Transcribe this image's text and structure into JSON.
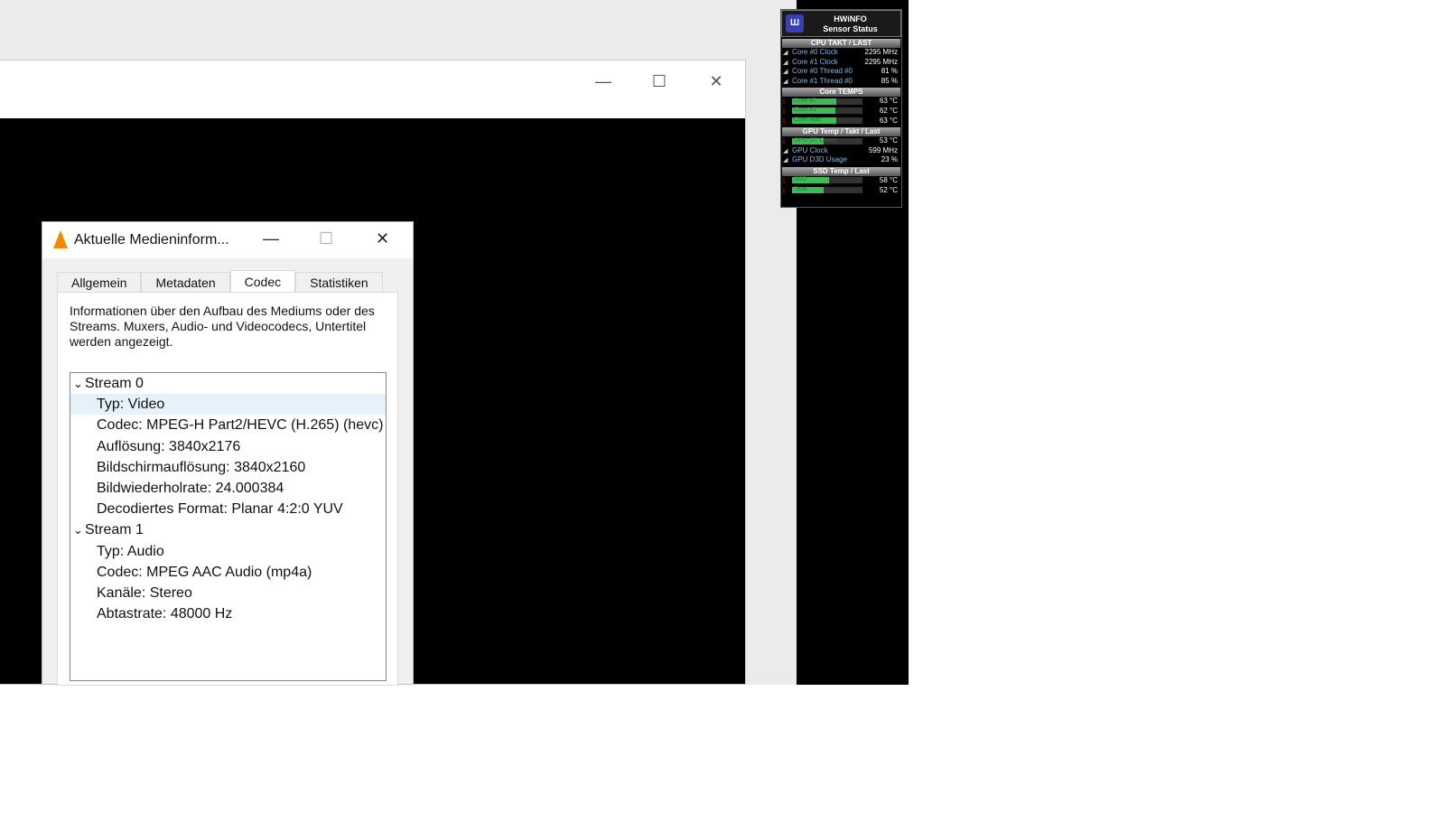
{
  "player": {
    "min": "—",
    "max": "☐",
    "close": "✕"
  },
  "dialog": {
    "title": "Aktuelle Medieninform...",
    "min": "—",
    "max": "☐",
    "close": "✕",
    "tabs": [
      "Allgemein",
      "Metadaten",
      "Codec",
      "Statistiken"
    ],
    "desc": "Informationen über den Aufbau des Mediums oder des Streams. Muxers, Audio- und Videocodecs, Untertitel werden angezeigt.",
    "streams": [
      {
        "label": "Stream 0",
        "items": [
          "Typ: Video",
          "Codec: MPEG-H Part2/HEVC (H.265) (hevc)",
          "Auflösung: 3840x2176",
          "Bildschirmauflösung: 3840x2160",
          "Bildwiederholrate: 24.000384",
          "Decodiertes Format: Planar 4:2:0 YUV"
        ]
      },
      {
        "label": "Stream 1",
        "items": [
          "Typ: Audio",
          "Codec: MPEG AAC Audio (mp4a)",
          "Kanäle: Stereo",
          "Abtastrate: 48000 Hz"
        ]
      }
    ]
  },
  "hwinfo": {
    "title1": "HWiNFO",
    "title2": "Sensor Status",
    "s1": "CPU TAKT / LAST",
    "cpu": [
      {
        "l": "Core #0 Clock",
        "v": "2295 MHz"
      },
      {
        "l": "Core #1 Clock",
        "v": "2295 MHz"
      },
      {
        "l": "Core #0 Thread #0",
        "v": "81 %"
      },
      {
        "l": "Core #1 Thread #0",
        "v": "85 %"
      }
    ],
    "s2": "Core TEMPS",
    "temps": [
      {
        "l": "Core #0",
        "v": "63 °C",
        "p": 63
      },
      {
        "l": "Core #1",
        "v": "62 °C",
        "p": 62
      },
      {
        "l": "Core Max",
        "v": "63 °C",
        "p": 63
      }
    ],
    "s3": "GPU Temp / Takt / Last",
    "gpu_temp": {
      "l": "GPU GT Cores",
      "v": "53 °C",
      "p": 45
    },
    "gpu": [
      {
        "l": "GPU Clock",
        "v": "599 MHz"
      },
      {
        "l": "GPU D3D Usage",
        "v": "23 %"
      }
    ],
    "s4": "SSD Temp / Last",
    "ssd": [
      {
        "l": "SSD",
        "v": "58 °C",
        "p": 52
      },
      {
        "l": "Total",
        "v": "52 °C",
        "p": 45
      }
    ]
  }
}
